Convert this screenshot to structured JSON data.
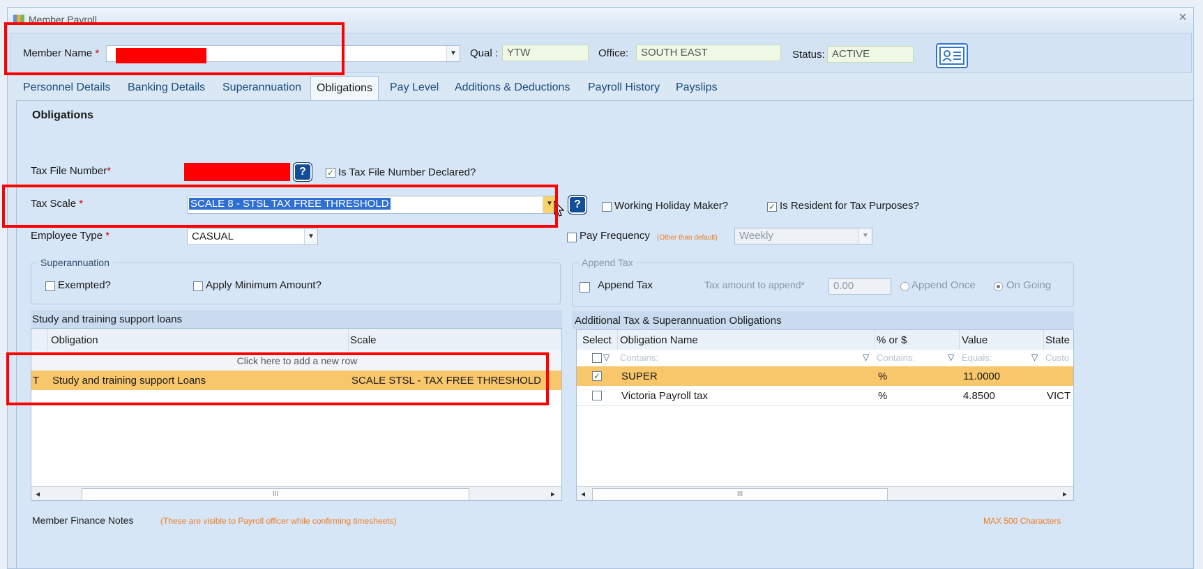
{
  "window": {
    "title": "Member Payroll",
    "close": "×"
  },
  "member": {
    "name_label": "Member Name",
    "required": "*",
    "qual_label": "Qual :",
    "qual_value": "YTW",
    "office_label": "Office:",
    "office_value": "SOUTH EAST",
    "status_label": "Status:",
    "status_value": "ACTIVE"
  },
  "tabs": [
    {
      "label": "Personnel Details"
    },
    {
      "label": "Banking Details"
    },
    {
      "label": "Superannuation"
    },
    {
      "label": "Obligations"
    },
    {
      "label": "Pay Level"
    },
    {
      "label": "Additions & Deductions"
    },
    {
      "label": "Payroll History"
    },
    {
      "label": "Payslips"
    }
  ],
  "obligations": {
    "title": "Obligations",
    "tfn_label": "Tax File Number",
    "tfn_declared_label": "Is Tax File Number Declared?",
    "tax_scale_label": "Tax Scale",
    "tax_scale_value": "SCALE 8 - STSL TAX FREE THRESHOLD",
    "working_holiday_label": "Working Holiday Maker?",
    "resident_label": "Is Resident for Tax Purposes?",
    "employee_type_label": "Employee Type",
    "employee_type_value": "CASUAL",
    "pay_frequency_label": "Pay Frequency",
    "pay_frequency_note": "(Other than default)",
    "pay_frequency_value": "Weekly",
    "help": "?",
    "check": "✓"
  },
  "superannuation": {
    "title": "Superannuation",
    "exempted_label": "Exempted?",
    "apply_min_label": "Apply Minimum Amount?"
  },
  "append_tax": {
    "title": "Append Tax",
    "append_label": "Append Tax",
    "amount_label": "Tax amount to append",
    "amount_value": "0.00",
    "once_label": "Append Once",
    "ongoing_label": "On Going"
  },
  "stsl": {
    "title": "Study and training support loans",
    "col_obligation": "Obligation",
    "col_scale": "Scale",
    "add_row": "Click here to add a new row",
    "row_marker": "T",
    "rows": [
      {
        "obligation": "Study and training support Loans",
        "scale": "SCALE STSL - TAX FREE THRESHOLD"
      }
    ]
  },
  "additional": {
    "title": "Additional Tax & Superannuation Obligations",
    "col_select": "Select",
    "col_name": "Obligation Name",
    "col_pct": "% or $",
    "col_value": "Value",
    "col_state": "State",
    "filter_contains": "Contains:",
    "filter_equals": "Equals:",
    "filter_custom": "Custo",
    "rows": [
      {
        "name": "SUPER",
        "pct": "%",
        "value": "11.0000",
        "state": "",
        "selected": true
      },
      {
        "name": "Victoria Payroll tax",
        "pct": "%",
        "value": "4.8500",
        "state": "VICT",
        "selected": false
      }
    ]
  },
  "notes": {
    "label": "Member Finance Notes",
    "hint": "(These are visible to Payroll officer while confirming timesheets)",
    "max": "MAX 500 Characters"
  },
  "scroll": {
    "left": "◂",
    "right": "▸",
    "grip": "III"
  },
  "colors": {
    "red_box": "#ff0000",
    "selected_row": "#f8c66b",
    "help_blue": "#134c98"
  },
  "icons": [
    "app-icon",
    "close-icon",
    "dropdown-arrow-icon",
    "help-icon",
    "member-card-icon",
    "filter-icon",
    "mouse-cursor-icon"
  ]
}
